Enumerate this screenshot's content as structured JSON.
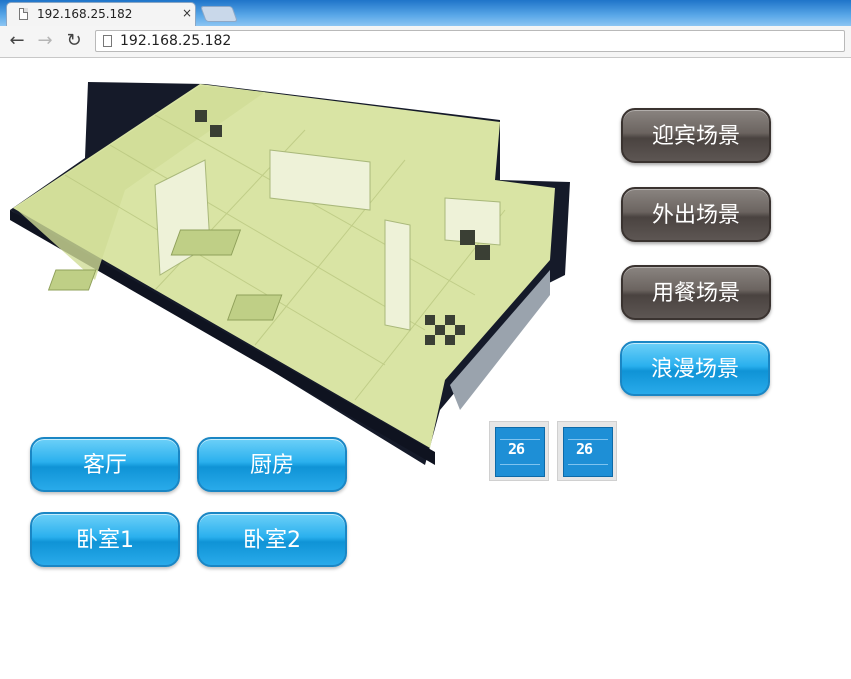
{
  "browser": {
    "tab_title": "192.168.25.182",
    "tab_close": "×",
    "address": "192.168.25.182"
  },
  "scenes": [
    {
      "label": "迎宾场景",
      "style": "dark"
    },
    {
      "label": "外出场景",
      "style": "dark"
    },
    {
      "label": "用餐场景",
      "style": "dark"
    },
    {
      "label": "浪漫场景",
      "style": "blue"
    }
  ],
  "rooms": [
    {
      "label": "客厅"
    },
    {
      "label": "厨房"
    },
    {
      "label": "卧室1"
    },
    {
      "label": "卧室2"
    }
  ],
  "thermostats": [
    {
      "temperature": "26"
    },
    {
      "temperature": "26"
    }
  ],
  "colors": {
    "floor_tint": "#d6e3a0",
    "wall_dark": "#1a1f2e",
    "scene_dark": "#5d5653",
    "scene_blue": "#1faae9"
  }
}
